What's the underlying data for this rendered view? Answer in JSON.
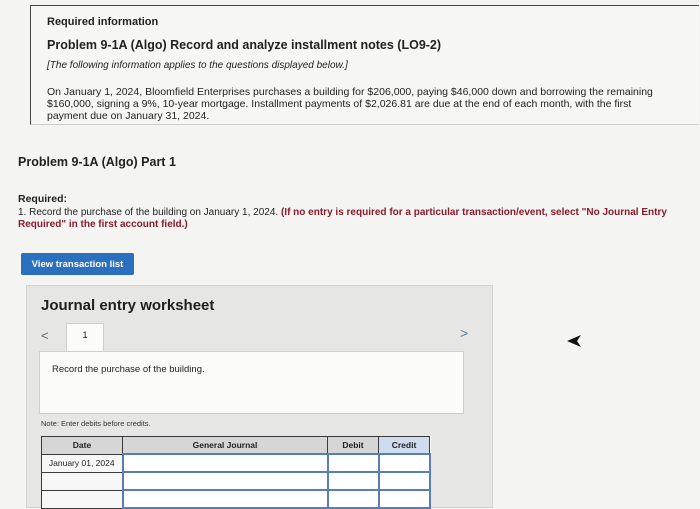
{
  "info": {
    "required_information": "Required information",
    "problem_title": "Problem 9-1A (Algo) Record and analyze installment notes (LO9-2)",
    "note_italic": "[The following information applies to the questions displayed below.]",
    "description": "On January 1, 2024, Bloomfield Enterprises purchases a building for $206,000, paying $46,000 down and borrowing the remaining $160,000, signing a 9%, 10-year mortgage. Installment payments of $2,026.81 are due at the end of each month, with the first payment due on January 31, 2024."
  },
  "part": {
    "title": "Problem 9-1A (Algo) Part 1"
  },
  "required": {
    "label": "Required:",
    "text": "1. Record the purchase of the building on January 1, 2024. ",
    "red_text": "(If no entry is required for a particular transaction/event, select \"No Journal Entry Required\" in the first account field.)"
  },
  "buttons": {
    "view_transaction_list": "View transaction list"
  },
  "worksheet": {
    "title": "Journal entry worksheet",
    "prev": "<",
    "next": ">",
    "tab_number": "1",
    "description": "Record the purchase of the building.",
    "note": "Note: Enter debits before credits."
  },
  "table": {
    "headers": [
      "Date",
      "General Journal",
      "Debit",
      "Credit"
    ],
    "rows": [
      [
        "January 01, 2024",
        "",
        "",
        ""
      ],
      [
        "",
        "",
        "",
        ""
      ],
      [
        "",
        "",
        "",
        ""
      ]
    ]
  }
}
